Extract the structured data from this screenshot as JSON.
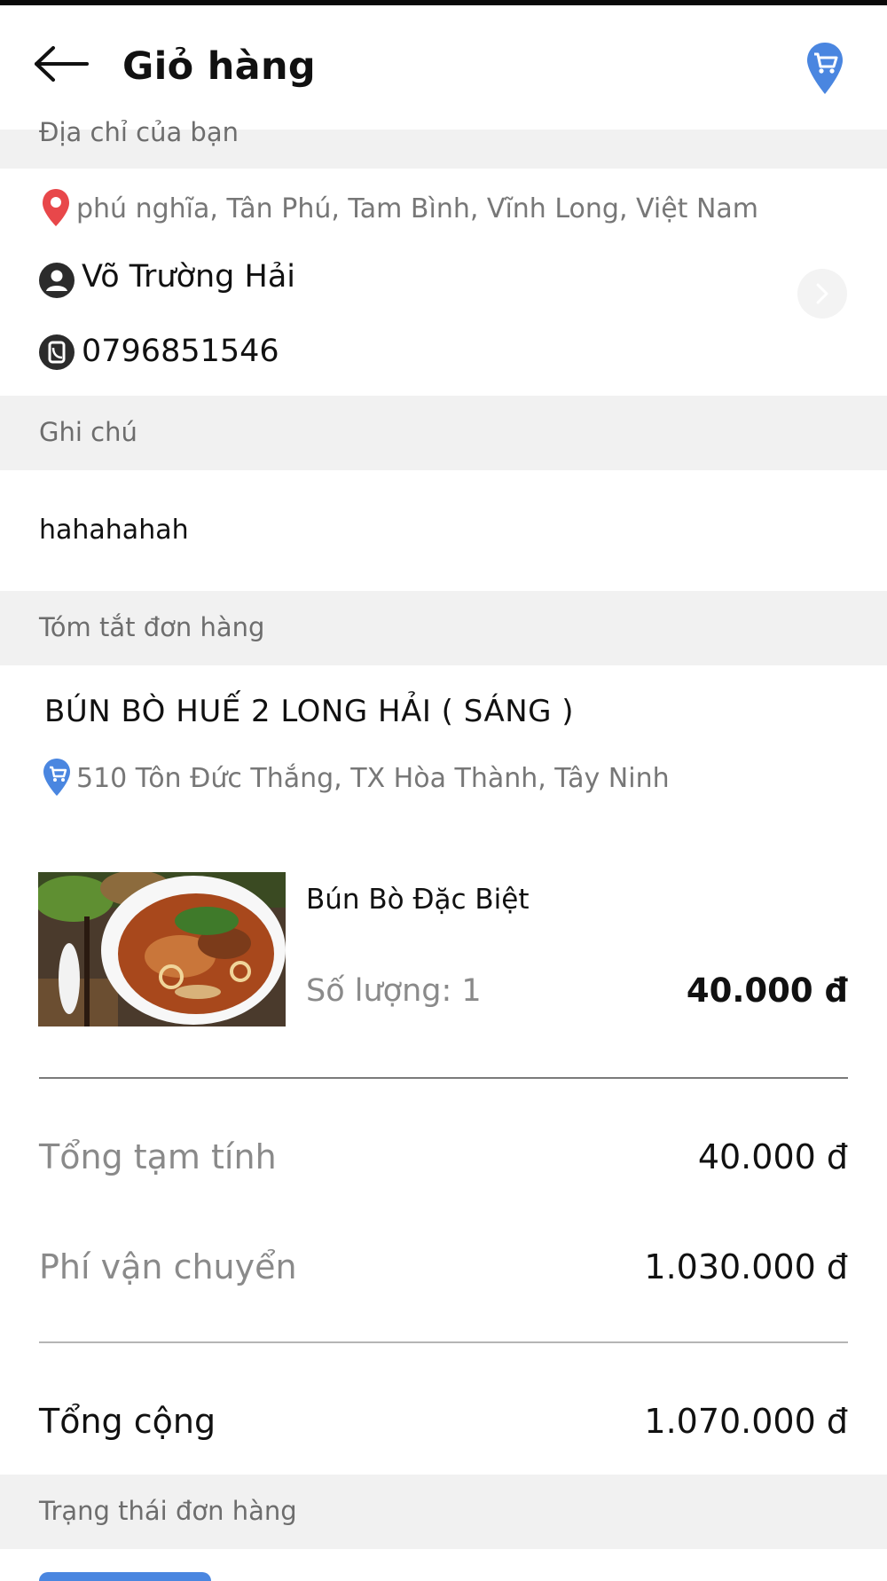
{
  "header": {
    "title": "Giỏ hàng",
    "back_icon": "arrow-left-icon",
    "cart_icon": "cart-pin-icon"
  },
  "address_section": {
    "label": "Địa chỉ của bạn",
    "address": "phú nghĩa, Tân Phú, Tam Bình, Vĩnh Long, Việt Nam",
    "name": "Võ Trường Hải",
    "phone": "0796851546"
  },
  "note_section": {
    "label": "Ghi chú",
    "value": "hahahahah"
  },
  "summary_section": {
    "label": "Tóm tắt đơn hàng",
    "shop_name": "BÚN BÒ HUẾ 2  LONG HẢI ( SÁNG )",
    "shop_address": "510 Tôn Đức Thắng, TX Hòa Thành, Tây Ninh",
    "item": {
      "name": "Bún Bò Đặc Biệt",
      "quantity": "Số lượng: 1",
      "price": "40.000 đ"
    },
    "subtotal_label": "Tổng tạm tính",
    "subtotal_value": "40.000 đ",
    "shipping_label": "Phí vận chuyển",
    "shipping_value": "1.030.000 đ",
    "total_label": "Tổng cộng",
    "total_value": "1.070.000 đ"
  },
  "status_section": {
    "label": "Trạng thái đơn hàng"
  },
  "colors": {
    "accent_blue": "#4a86e0",
    "pin_red": "#e8474a",
    "section_bg": "#f1f1f1"
  }
}
